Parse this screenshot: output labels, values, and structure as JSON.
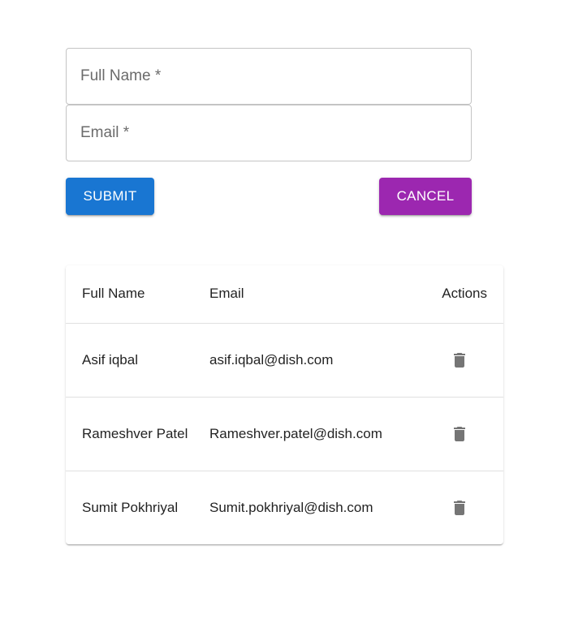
{
  "form": {
    "full_name_placeholder": "Full Name *",
    "full_name_value": "",
    "email_placeholder": "Email *",
    "email_value": "",
    "submit_label": "SUBMIT",
    "cancel_label": "CANCEL"
  },
  "table": {
    "headers": {
      "full_name": "Full Name",
      "email": "Email",
      "actions": "Actions"
    },
    "rows": [
      {
        "full_name": "Asif iqbal",
        "email": "asif.iqbal@dish.com",
        "action_icon": "trash-icon"
      },
      {
        "full_name": "Rameshver Patel",
        "email": "Rameshver.patel@dish.com",
        "action_icon": "trash-icon"
      },
      {
        "full_name": "Sumit Pokhriyal",
        "email": "Sumit.pokhriyal@dish.com",
        "action_icon": "trash-icon"
      }
    ]
  },
  "colors": {
    "submit": "#1976d2",
    "cancel": "#9c27b0",
    "icon": "#757575"
  }
}
